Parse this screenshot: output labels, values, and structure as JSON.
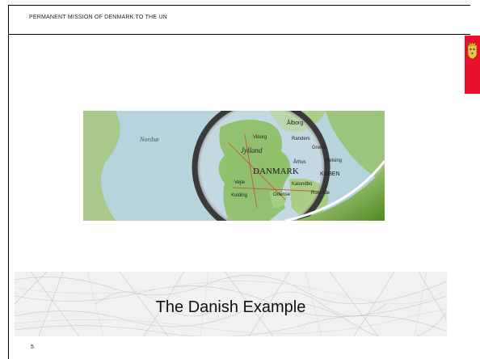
{
  "header": {
    "text": "PERMANENT MISSION OF DENMARK TO THE UN"
  },
  "map": {
    "labels": {
      "north_sea": "Nordsø",
      "aalborg": "Ålborg",
      "viborg": "Viborg",
      "randers": "Randers",
      "grenaa": "Grenå",
      "jylland": "Jylland",
      "arhus": "Århus",
      "helsingor": "Helsing",
      "danmark": "DANMARK",
      "kobenhavn": "KØBEN",
      "vejle": "Vejle",
      "kalundborg": "Kalundbo",
      "kolding": "Kolding",
      "odense": "Odense",
      "roskilde": "Roskilde"
    },
    "colors": {
      "sea": "#b7d3dd",
      "land": "#8fbf6a",
      "accent_green": "#6ea43a"
    }
  },
  "title": {
    "text": "The Danish Example"
  },
  "footer": {
    "page_number": "5"
  },
  "colors": {
    "flag_red": "#e8112d",
    "border": "#000000"
  }
}
